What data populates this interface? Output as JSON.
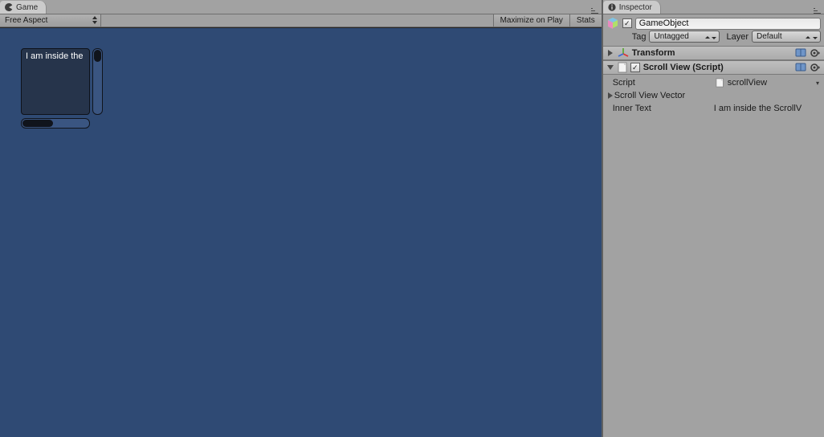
{
  "game": {
    "tab_label": "Game",
    "aspect": "Free Aspect",
    "maximize_label": "Maximize on Play",
    "stats_label": "Stats",
    "scroll_text": "I am inside the"
  },
  "inspector": {
    "tab_label": "Inspector",
    "gameobject_name": "GameObject",
    "enabled": true,
    "tag_label": "Tag",
    "tag_value": "Untagged",
    "layer_label": "Layer",
    "layer_value": "Default",
    "components": {
      "transform": {
        "title": "Transform"
      },
      "scrollview": {
        "title": "Scroll View (Script)",
        "enabled": true,
        "script_label": "Script",
        "script_value": "scrollView",
        "vector_label": "Scroll View Vector",
        "innertext_label": "Inner Text",
        "innertext_value": "I am inside the ScrollV"
      }
    }
  }
}
